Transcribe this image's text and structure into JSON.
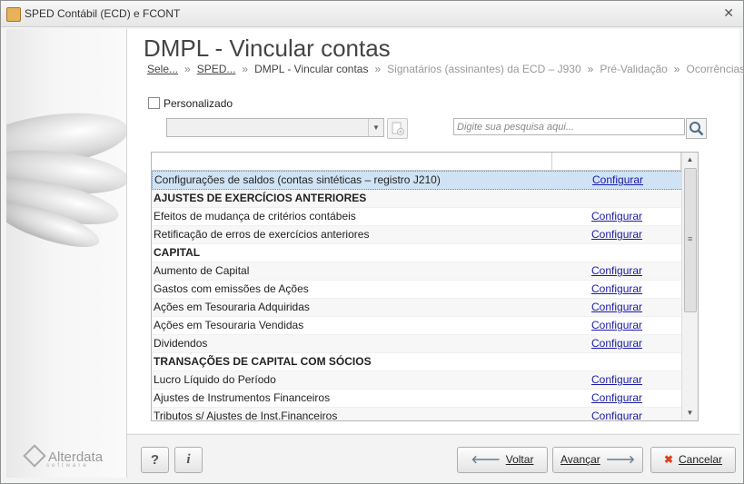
{
  "window": {
    "title": "SPED Contábil (ECD) e FCONT",
    "close_glyph": "✕"
  },
  "page": {
    "heading": "DMPL - Vincular contas"
  },
  "breadcrumb": {
    "sep": "»",
    "items": [
      "Sele...",
      "SPED...",
      "DMPL - Vincular contas",
      "Signatários (assinantes) da ECD – J930",
      "Pré-Validação",
      "Ocorrências"
    ]
  },
  "filter": {
    "personalizado_label": "Personalizado",
    "personalizado_checked": false,
    "combo_value": ""
  },
  "search": {
    "placeholder": "Digite sua pesquisa aqui..."
  },
  "grid": {
    "link_text": "Configurar",
    "rows": [
      {
        "label": "Configurações de saldos (contas sintéticas – registro J210)",
        "type": "item",
        "selected": true
      },
      {
        "label": "AJUSTES DE EXERCÍCIOS ANTERIORES",
        "type": "group"
      },
      {
        "label": "Efeitos de mudança de critérios contábeis",
        "type": "item"
      },
      {
        "label": "Retificação de erros de exercícios anteriores",
        "type": "item"
      },
      {
        "label": "CAPITAL",
        "type": "group"
      },
      {
        "label": "Aumento de Capital",
        "type": "item"
      },
      {
        "label": "Gastos com emissões de Ações",
        "type": "item"
      },
      {
        "label": "Ações em Tesouraria Adquiridas",
        "type": "item"
      },
      {
        "label": "Ações em Tesouraria Vendidas",
        "type": "item"
      },
      {
        "label": "Dividendos",
        "type": "item"
      },
      {
        "label": "TRANSAÇÕES DE CAPITAL COM SÓCIOS",
        "type": "group"
      },
      {
        "label": "Lucro Líquido do Período",
        "type": "item"
      },
      {
        "label": "Ajustes de Instrumentos Financeiros",
        "type": "item"
      },
      {
        "label": "Tributos s/ Ajustes de Inst.Financeiros",
        "type": "item"
      }
    ]
  },
  "sidebar": {
    "logo": "Alterdata",
    "logo_sub": "software"
  },
  "footer": {
    "help_label": "?",
    "info_label": "i",
    "back_icon": "🡐",
    "back_label": "Voltar",
    "next_label": "Avançar",
    "next_icon": "🡒",
    "cancel_icon": "✖",
    "cancel_label": "Cancelar"
  },
  "colors": {
    "link": "#1a1aa6",
    "selected_row": "#cfe3f5",
    "cancel_icon": "#d9431e",
    "arrow_icon": "#6b7d8c"
  }
}
